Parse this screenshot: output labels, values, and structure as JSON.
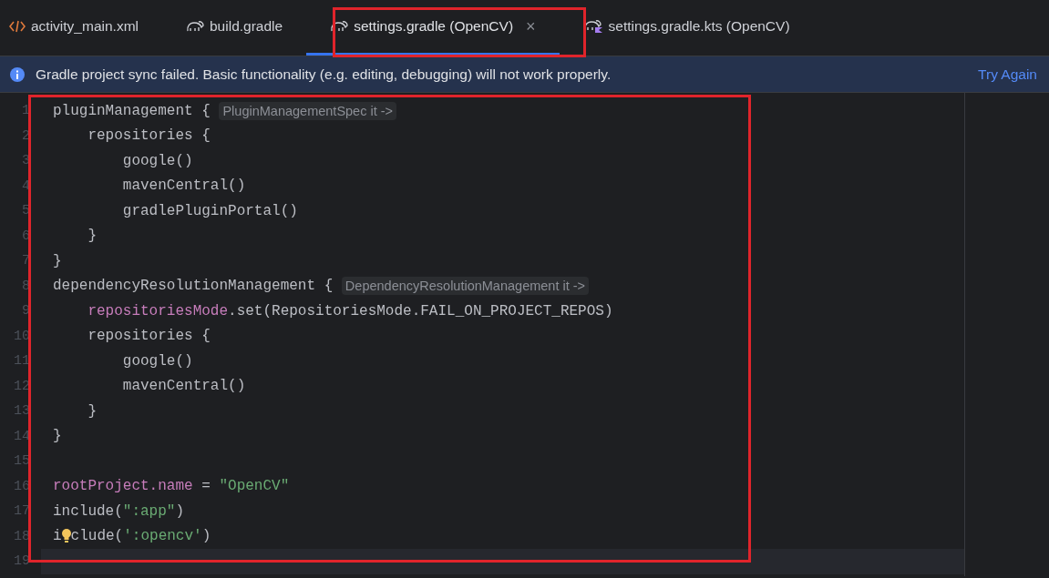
{
  "tabs": [
    {
      "label": "activity_main.xml",
      "kind": "xml",
      "selected": false
    },
    {
      "label": "build.gradle",
      "kind": "gradle",
      "selected": false
    },
    {
      "label": "settings.gradle (OpenCV)",
      "kind": "gradle",
      "selected": true,
      "close": "×"
    },
    {
      "label": "settings.gradle.kts (OpenCV)",
      "kind": "kts",
      "selected": false
    }
  ],
  "banner": {
    "message": "Gradle project sync failed. Basic functionality (e.g. editing, debugging) will not work properly.",
    "action": "Try Again"
  },
  "editor": {
    "lines": [
      {
        "number": "1",
        "current": false,
        "segments": [
          {
            "kind": "plain",
            "text": "pluginManagement { "
          },
          {
            "kind": "hint",
            "text": "PluginManagementSpec it ->"
          }
        ]
      },
      {
        "number": "2",
        "current": false,
        "segments": [
          {
            "kind": "plain",
            "text": "    repositories {"
          }
        ]
      },
      {
        "number": "3",
        "current": false,
        "segments": [
          {
            "kind": "plain",
            "text": "        google()"
          }
        ]
      },
      {
        "number": "4",
        "current": false,
        "segments": [
          {
            "kind": "plain",
            "text": "        mavenCentral()"
          }
        ]
      },
      {
        "number": "5",
        "current": false,
        "segments": [
          {
            "kind": "plain",
            "text": "        gradlePluginPortal()"
          }
        ]
      },
      {
        "number": "6",
        "current": false,
        "segments": [
          {
            "kind": "plain",
            "text": "    }"
          }
        ]
      },
      {
        "number": "7",
        "current": false,
        "segments": [
          {
            "kind": "plain",
            "text": "}"
          }
        ]
      },
      {
        "number": "8",
        "current": false,
        "segments": [
          {
            "kind": "plain",
            "text": "dependencyResolutionManagement { "
          },
          {
            "kind": "hint",
            "text": "DependencyResolutionManagement it ->"
          }
        ]
      },
      {
        "number": "9",
        "current": false,
        "segments": [
          {
            "kind": "property",
            "text": "    repositoriesMode"
          },
          {
            "kind": "plain",
            "text": ".set(RepositoriesMode.FAIL_ON_PROJECT_REPOS)"
          }
        ]
      },
      {
        "number": "10",
        "current": false,
        "segments": [
          {
            "kind": "plain",
            "text": "    repositories {"
          }
        ]
      },
      {
        "number": "11",
        "current": false,
        "segments": [
          {
            "kind": "plain",
            "text": "        google()"
          }
        ]
      },
      {
        "number": "12",
        "current": false,
        "segments": [
          {
            "kind": "plain",
            "text": "        mavenCentral()"
          }
        ]
      },
      {
        "number": "13",
        "current": false,
        "segments": [
          {
            "kind": "plain",
            "text": "    }"
          }
        ]
      },
      {
        "number": "14",
        "current": false,
        "segments": [
          {
            "kind": "plain",
            "text": "}"
          }
        ]
      },
      {
        "number": "15",
        "current": false
      },
      {
        "number": "16",
        "current": false,
        "segments": [
          {
            "kind": "property",
            "text": "rootProject.name"
          },
          {
            "kind": "plain",
            "text": " = "
          },
          {
            "kind": "string",
            "text": "\"OpenCV\""
          }
        ]
      },
      {
        "number": "17",
        "current": false,
        "segments": [
          {
            "kind": "plain",
            "text": "include("
          },
          {
            "kind": "string",
            "text": "\":app\""
          },
          {
            "kind": "plain",
            "text": ")"
          }
        ]
      },
      {
        "number": "18",
        "current": false,
        "segments": [
          {
            "kind": "plain",
            "text": "i"
          },
          {
            "kind": "bulb"
          },
          {
            "kind": "plain",
            "text": "clude("
          },
          {
            "kind": "string",
            "text": "':opencv'"
          },
          {
            "kind": "plain",
            "text": ")"
          }
        ]
      },
      {
        "number": "19",
        "current": true
      }
    ]
  }
}
